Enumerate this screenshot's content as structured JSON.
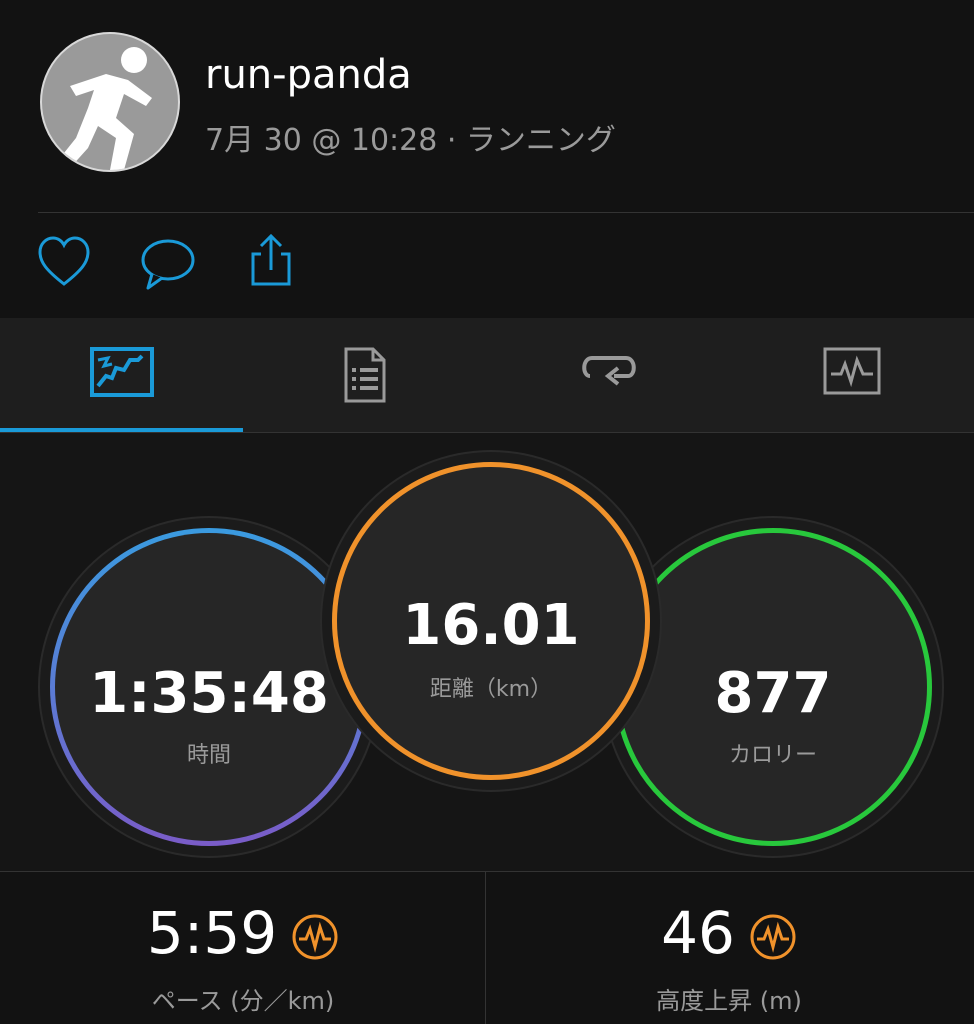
{
  "header": {
    "username": "run-panda",
    "subtitle": "7月 30 @ 10:28 · ランニング"
  },
  "actions": {
    "like_icon": "heart-icon",
    "comment_icon": "comment-icon",
    "share_icon": "share-icon"
  },
  "tabs": [
    {
      "name": "map-tab",
      "icon": "map-icon",
      "active": true
    },
    {
      "name": "details-tab",
      "icon": "document-icon",
      "active": false
    },
    {
      "name": "laps-tab",
      "icon": "repeat-icon",
      "active": false
    },
    {
      "name": "graphs-tab",
      "icon": "chart-icon",
      "active": false
    }
  ],
  "metrics": {
    "time": {
      "value": "1:35:48",
      "label": "時間"
    },
    "distance": {
      "value": "16.01",
      "label": "距離（km）"
    },
    "calories": {
      "value": "877",
      "label": "カロリー"
    }
  },
  "stats": {
    "pace": {
      "value": "5:59",
      "label": "ペース (分／km)"
    },
    "elevation": {
      "value": "46",
      "label": "高度上昇 (m)"
    }
  },
  "colors": {
    "accent": "#1a9ad8",
    "time_ring_top": "#3a9be0",
    "time_ring_bottom": "#7a5cc8",
    "distance_ring": "#f0922b",
    "calories_ring": "#28c83c",
    "badge": "#f0922b"
  }
}
